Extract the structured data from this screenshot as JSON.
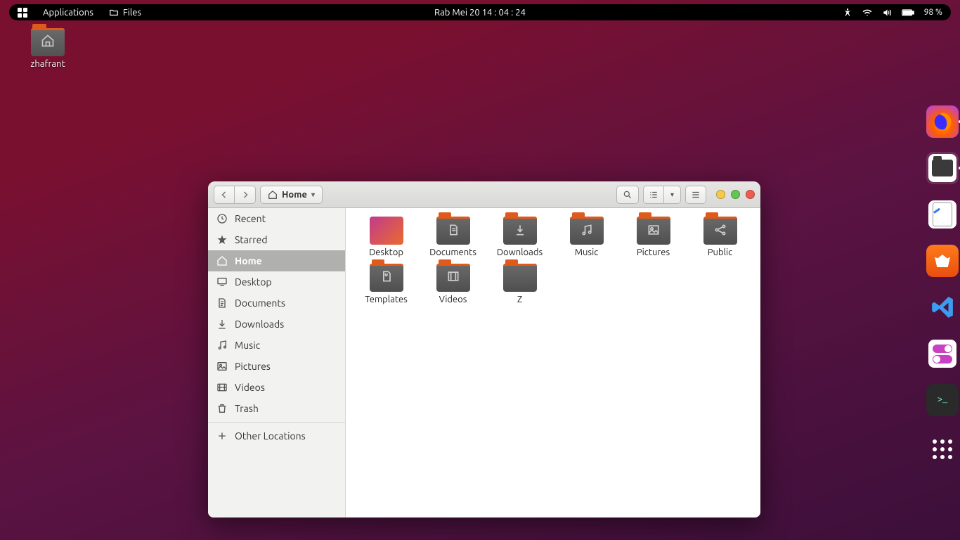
{
  "panel": {
    "apps": "Applications",
    "files": "Files",
    "clock": "Rab Mei 20  14 : 04 : 24",
    "battery": "98 %"
  },
  "desktop": {
    "home_folder_label": "zhafrant"
  },
  "dock": {
    "items": [
      {
        "name": "firefox",
        "running": true
      },
      {
        "name": "files",
        "running": true,
        "active": true
      },
      {
        "name": "text-editor",
        "running": false
      },
      {
        "name": "ubuntu-software",
        "running": false
      },
      {
        "name": "vscode",
        "running": false
      },
      {
        "name": "gnome-tweaks",
        "running": false
      },
      {
        "name": "terminal",
        "running": false
      },
      {
        "name": "show-applications",
        "running": false
      }
    ]
  },
  "files_window": {
    "path_label": "Home",
    "sidebar": [
      {
        "icon": "clock",
        "label": "Recent"
      },
      {
        "icon": "star",
        "label": "Starred"
      },
      {
        "icon": "home",
        "label": "Home",
        "active": true
      },
      {
        "icon": "desktop",
        "label": "Desktop"
      },
      {
        "icon": "document",
        "label": "Documents"
      },
      {
        "icon": "download",
        "label": "Downloads"
      },
      {
        "icon": "music",
        "label": "Music"
      },
      {
        "icon": "picture",
        "label": "Pictures"
      },
      {
        "icon": "video",
        "label": "Videos"
      },
      {
        "icon": "trash",
        "label": "Trash"
      }
    ],
    "other_locations": "Other Locations",
    "folders": [
      {
        "label": "Desktop",
        "icon": "gradient"
      },
      {
        "label": "Documents",
        "icon": "document"
      },
      {
        "label": "Downloads",
        "icon": "download"
      },
      {
        "label": "Music",
        "icon": "music"
      },
      {
        "label": "Pictures",
        "icon": "picture"
      },
      {
        "label": "Public",
        "icon": "share"
      },
      {
        "label": "Templates",
        "icon": "template"
      },
      {
        "label": "Videos",
        "icon": "video"
      },
      {
        "label": "Z",
        "icon": "plain"
      }
    ]
  }
}
